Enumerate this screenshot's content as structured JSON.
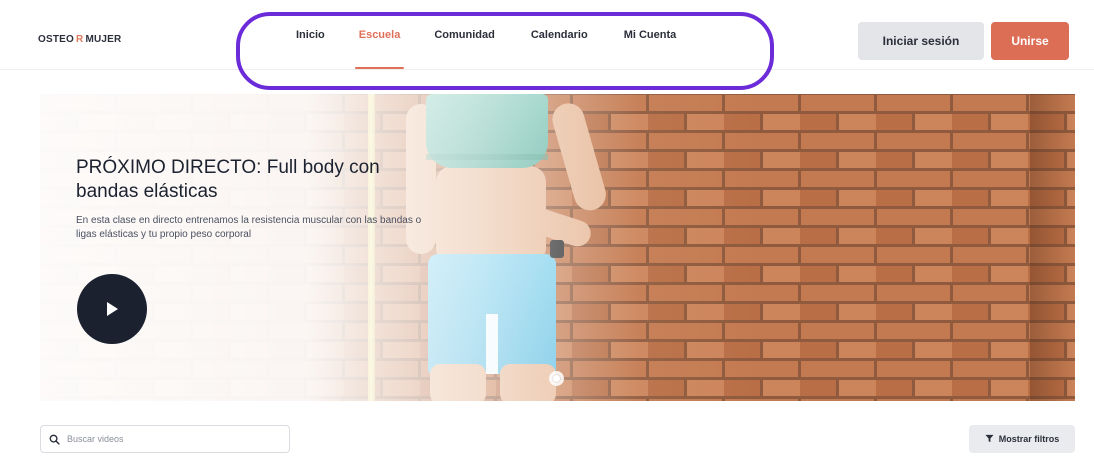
{
  "header": {
    "logo": {
      "left": "OSTEO",
      "mark": "R",
      "right": "MUJER"
    },
    "nav": [
      {
        "label": "Inicio",
        "active": false
      },
      {
        "label": "Escuela",
        "active": true
      },
      {
        "label": "Comunidad",
        "active": false
      },
      {
        "label": "Calendario",
        "active": false
      },
      {
        "label": "Mi Cuenta",
        "active": false
      }
    ],
    "login_label": "Iniciar sesión",
    "join_label": "Unirse"
  },
  "hero": {
    "title": "PRÓXIMO DIRECTO: Full body con bandas elásticas",
    "description": "En esta clase en directo entrenamos la resistencia muscular con las bandas o ligas elásticas y tu propio peso corporal"
  },
  "search": {
    "placeholder": "Buscar videos",
    "value": ""
  },
  "filters": {
    "label": "Mostrar filtros"
  },
  "colors": {
    "accent": "#dc6e56",
    "active_nav": "#e0705a",
    "highlight_ring": "#6b2bd9",
    "play_button": "#1c2130"
  }
}
